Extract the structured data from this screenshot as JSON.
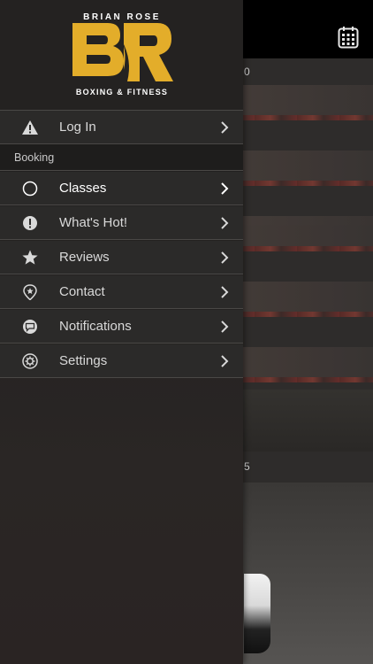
{
  "brand": {
    "name_top": "BRIAN ROSE",
    "name_bottom": "BOXING & FITNESS",
    "monogram": "BR",
    "gold_color": "#e3ad2a"
  },
  "main": {
    "date_label_1": "0",
    "date_label_2": "5",
    "calendar_icon": "calendar-icon"
  },
  "menu": {
    "login": {
      "label": "Log In",
      "icon": "warning-icon"
    },
    "section_booking": "Booking",
    "items": [
      {
        "label": "Classes",
        "icon": "circle-icon",
        "active": true
      },
      {
        "label": "What's Hot!",
        "icon": "exclamation-circle-icon",
        "active": false
      },
      {
        "label": "Reviews",
        "icon": "star-icon",
        "active": false
      },
      {
        "label": "Contact",
        "icon": "location-pin-icon",
        "active": false
      },
      {
        "label": "Notifications",
        "icon": "chat-bubble-icon",
        "active": false
      },
      {
        "label": "Settings",
        "icon": "gear-icon",
        "active": false
      }
    ]
  }
}
